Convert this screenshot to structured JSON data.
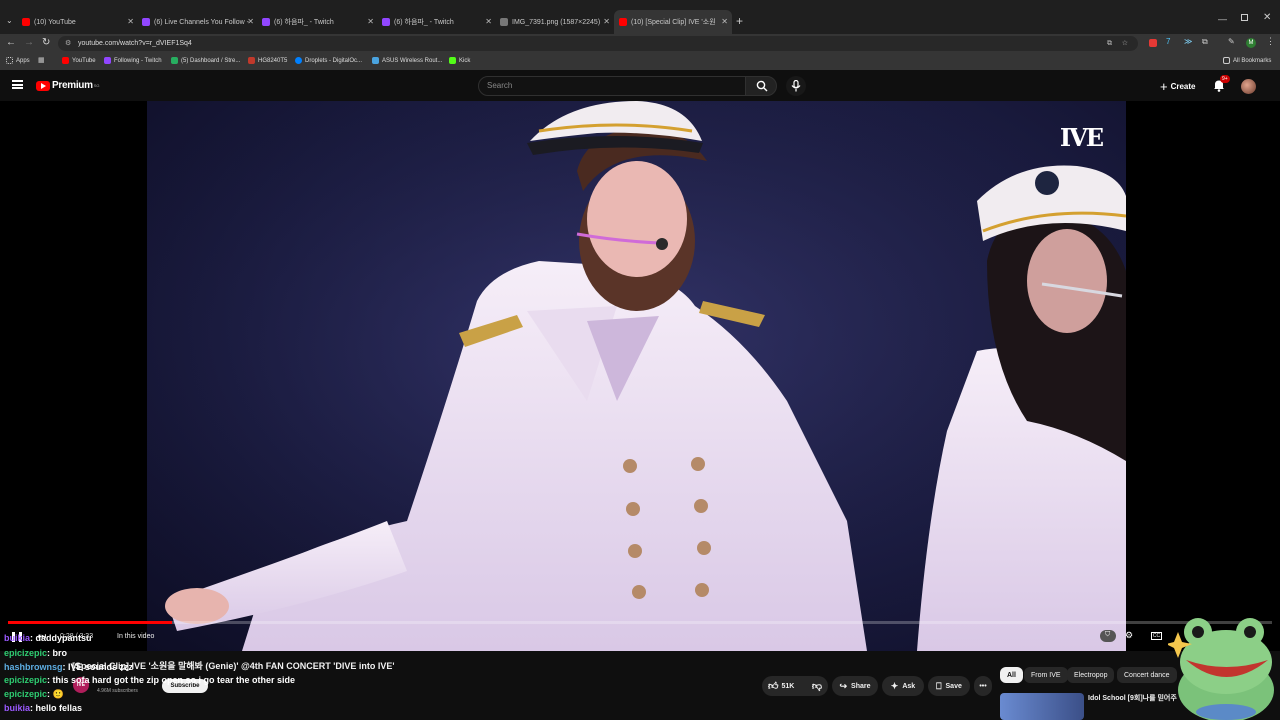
{
  "browser": {
    "tabs": [
      {
        "title": "(10) YouTube"
      },
      {
        "title": "(6) Live Channels You Follow - "
      },
      {
        "title": "(6) 하음파_ - Twitch"
      },
      {
        "title": "(6) 하음파_ - Twitch"
      },
      {
        "title": "IMG_7391.png (1587×2245)"
      },
      {
        "title": "(10) [Special Clip] IVE '소원"
      }
    ],
    "url": "youtube.com/watch?v=r_dVIEF1Sq4",
    "bookmarks": [
      {
        "label": "Apps"
      },
      {
        "label": "YouTube"
      },
      {
        "label": "Following - Twitch"
      },
      {
        "label": "(5) Dashboard / Stre..."
      },
      {
        "label": "HG8240T5"
      },
      {
        "label": "Droplets - DigitalOc..."
      },
      {
        "label": "ASUS Wireless Rout..."
      },
      {
        "label": "Kick"
      }
    ],
    "all_bookmarks": "All Bookmarks",
    "profile_initial": "M"
  },
  "yt": {
    "logo": "Premium",
    "logo_region": "SG",
    "search_placeholder": "Search",
    "create": "Create",
    "notif_count": "9+"
  },
  "video": {
    "watermark": "IVE",
    "time": "0:28 / 3:33",
    "in_this_video": "In this video",
    "title": "[Special Clip] IVE '소원을 말해봐 (Genie)' @4th FAN CONCERT 'DIVE into IVE'",
    "channel_subs": "4.96M subscribers",
    "subscribe": "Subscribe",
    "likes": "51K",
    "share": "Share",
    "ask": "Ask",
    "save": "Save",
    "progress": 0.13
  },
  "chips": [
    "All",
    "From IVE",
    "Electropop",
    "Concert dance"
  ],
  "recommend": {
    "title": "Idol School [9회]나를 믿어주"
  },
  "chat": [
    {
      "user": "buikia",
      "msg": "daddypantsu",
      "color": "#9b59ff"
    },
    {
      "user": "epicizepic",
      "msg": "bro",
      "color": "#2ecc71"
    },
    {
      "user": "hashbrownsg",
      "msg": "IVE sounds zzz",
      "color": "#5dade2"
    },
    {
      "user": "epicizepic",
      "msg": "this sofa hard got the zip open so i go tear the other side",
      "color": "#2ecc71"
    },
    {
      "user": "epicizepic",
      "msg": "🙂",
      "color": "#2ecc71"
    },
    {
      "user": "buikia",
      "msg": "hello fellas",
      "color": "#9b59ff"
    }
  ]
}
